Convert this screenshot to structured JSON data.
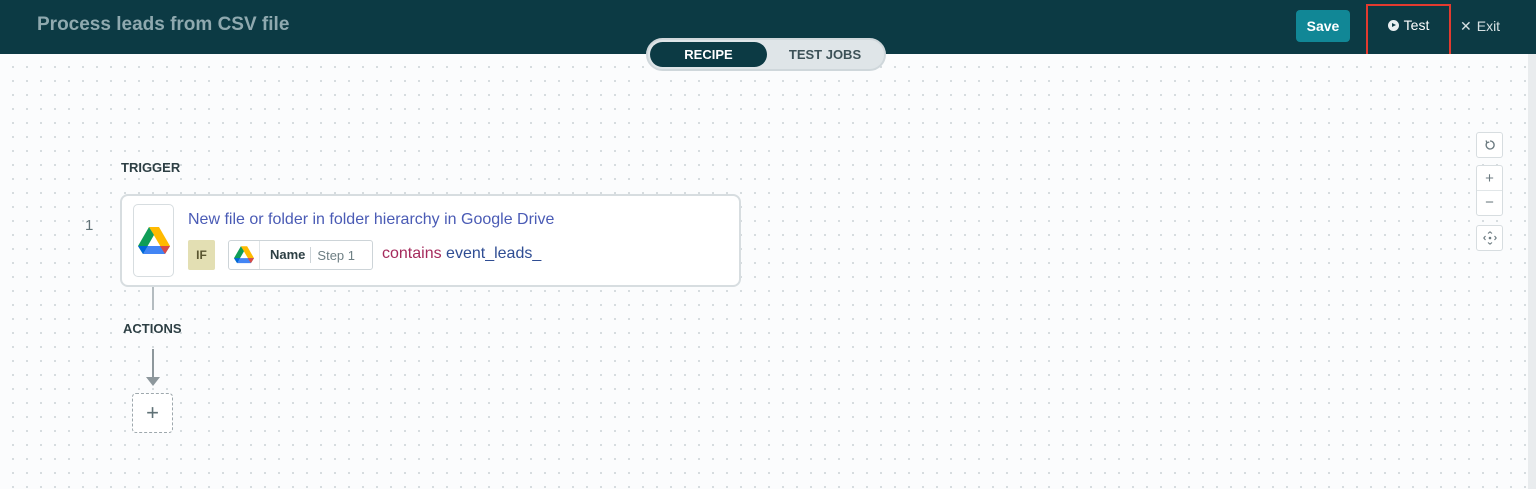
{
  "header": {
    "title": "Process leads from CSV file",
    "save_label": "Save",
    "test_label": "Test",
    "exit_label": "Exit"
  },
  "view_toggle": {
    "recipe_label": "RECIPE",
    "test_jobs_label": "TEST JOBS",
    "selected": "RECIPE"
  },
  "flow": {
    "trigger_label": "TRIGGER",
    "actions_label": "ACTIONS",
    "trigger_step": {
      "number": "1",
      "app_icon": "google-drive-icon",
      "title": "New file or folder in folder hierarchy in Google Drive",
      "if_label": "IF",
      "pill_field": "Name",
      "pill_step": "Step 1",
      "operator": "contains",
      "value": "event_leads_"
    },
    "add_step_label": "+"
  },
  "canvas_controls": {
    "reset_icon": "refresh-icon",
    "zoom_in_label": "+",
    "zoom_out_label": "−",
    "fit_icon": "fit-view-icon"
  },
  "colors": {
    "topbar": "#0c3a44",
    "save_button": "#118796",
    "highlight_outline": "#e23a2f"
  }
}
